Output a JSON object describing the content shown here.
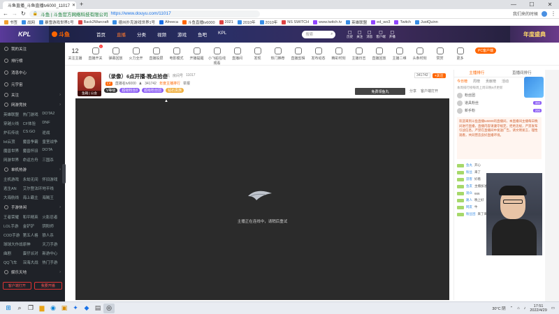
{
  "browser": {
    "tabs": [
      {
        "label": "斗鱼直播_斗鱼直播tv6000_11017"
      },
      {
        "label": "+"
      }
    ],
    "window_controls": [
      "—",
      "☐",
      "✕"
    ],
    "url_prefix": "斗鱼 | 斗鱼官方网络科技有限公司",
    "url": "https://www.douyu.com/11017",
    "address_right": "我们来的时候",
    "bookmarks": [
      {
        "label": "书签",
        "color": "#f0a030"
      },
      {
        "label": "战网",
        "color": "#3a8ee6"
      },
      {
        "label": "暴雪游戏世界1号",
        "color": "#3a8ee6"
      },
      {
        "label": "Back2Warcraft",
        "color": "#d44"
      },
      {
        "label": "德州扑克游戏世界1号",
        "color": "#3a8ee6"
      },
      {
        "label": "Afreeca",
        "color": "#1a6ee6"
      },
      {
        "label": "斗鱼直播tv6000",
        "color": "#f60"
      },
      {
        "label": "2021",
        "color": "#d44"
      },
      {
        "label": "2010年",
        "color": "#3a8ee6"
      },
      {
        "label": "2010年",
        "color": "#3a8ee6"
      },
      {
        "label": "NS SWITCH",
        "color": "#d44"
      },
      {
        "label": "www.twitch.tv",
        "color": "#9146ff"
      },
      {
        "label": "英雄联盟",
        "color": "#3a8ee6"
      },
      {
        "label": "ed_wo3",
        "color": "#9146ff"
      },
      {
        "label": "Twitch",
        "color": "#9146ff"
      },
      {
        "label": "JustQuinn",
        "color": "#3a8ee6"
      }
    ]
  },
  "site": {
    "logo_text": "斗鱼",
    "kpl_text": "KPL",
    "nav": [
      "首页",
      "直播",
      "分类",
      "视频",
      "游戏",
      "鱼吧",
      "KPL"
    ],
    "search_placeholder": "搜索",
    "header_icons": [
      "历史",
      "关注",
      "消息",
      "客户端",
      "开播"
    ],
    "banner_text": "年度盛典"
  },
  "sidebar": {
    "main_items": [
      "我的关注",
      "排行榜",
      "消息中心",
      "元宇宙"
    ],
    "follow_label": "关注",
    "sections": [
      {
        "title": "网游竞技",
        "items": [
          "英雄联盟",
          "热门游戏",
          "DOTA2",
          "穿越火线",
          "CF体验",
          "DNF",
          "炉石传说",
          "CS:GO",
          "逆战",
          "lol云顶",
          "魔兽争霸",
          "皇室战争",
          "魔兽世界",
          "魔兽怀旧",
          "DOTA",
          "网游世界",
          "命运方舟",
          "三国杀"
        ]
      },
      {
        "title": "单机热游",
        "items": [
          "主机游戏",
          "永劫无间",
          "怀旧游戏",
          "逃生AN",
          "艾尔登法环",
          "地平线",
          "大海航线",
          "海上霸主",
          "海贼王"
        ]
      },
      {
        "title": "手游休闲",
        "items": [
          "王者荣耀",
          "和平精英",
          "火影忍者",
          "LOL手游",
          "金铲铲",
          "阴阳师",
          "COD手游",
          "第五人格",
          "狼人杀",
          "球球大作战",
          "原神",
          "天刀手游",
          "曲剧",
          "蛋仔派对",
          "新游中心",
          "QQ飞车",
          "深海大战",
          "热门手游"
        ]
      },
      {
        "title": "娱乐天地",
        "items": []
      }
    ],
    "bottom_buttons": [
      "客户端打开",
      "我要开播"
    ]
  },
  "categories": [
    {
      "label": "12",
      "sub": "关注主播"
    },
    {
      "label": "直播开关",
      "badge": "1"
    },
    {
      "label": "弹幕回放"
    },
    {
      "label": "火力全开"
    },
    {
      "label": "直播投屏"
    },
    {
      "label": "电影模式"
    },
    {
      "label": "开播提醒"
    },
    {
      "label": "小飞船在线观看"
    },
    {
      "label": "直播间"
    },
    {
      "label": "发现"
    },
    {
      "label": "热门推荐"
    },
    {
      "label": "直播剪辑"
    },
    {
      "label": "发布动态"
    },
    {
      "label": "精彩时刻"
    },
    {
      "label": "主播日志"
    },
    {
      "label": "直播回放"
    },
    {
      "label": "主播二维"
    },
    {
      "label": "头条时刻"
    },
    {
      "label": "赞赏"
    },
    {
      "label": "更多"
    },
    {
      "label": "PC客户端",
      "highlight": true
    }
  ],
  "room": {
    "title": "（录像）6点开播-晚点拾叁",
    "category": "单机",
    "room_label": "房间号",
    "room_number": "11017",
    "streamer": "直播名tv6000",
    "followers": "341742",
    "rank_text": "年度主播排行",
    "report_label": "举报",
    "tags": [
      {
        "label": "V等级",
        "color": "#333"
      },
      {
        "label": "超级粉丝8",
        "color": "#8a5cf5"
      },
      {
        "label": "超级粉丝团",
        "color": "#8a5cf5"
      },
      {
        "label": "钻石贵族",
        "color": "#f0b040"
      }
    ],
    "follow_count": "341742",
    "follow_button": "+关注",
    "gift_text": "免费领鱼丸",
    "share_label": "分享",
    "client_label": "客户端打开",
    "avatar_caption": "鱼箱 | 公会"
  },
  "player": {
    "loading_text": "主播正在连线中，请稍后重试"
  },
  "right": {
    "tabs": [
      "主播排行",
      "直播间排行"
    ],
    "subtabs": [
      "今日榜",
      "周榜",
      "贡献榜",
      "活动"
    ],
    "notice": "本周排行榜每周上周日晚8点更新",
    "fans": [
      {
        "name": "粉丝团",
        "score": "300"
      },
      {
        "name": "道具粉丝",
        "score": "300"
      },
      {
        "name": "新手粉",
        "score": "200"
      }
    ],
    "announcement": "欢迎来到斗鱼直播tv6000的直播间，本直播间主播每日晚间进行直播，直播内容请遵守规定，拒绝违规，严禁发布引战信息。严禁在直播间中发送广告。请文明发言，理性观看，共同营造良好直播环境。",
    "chat": [
      {
        "user": "鱼丸",
        "msg": "开心"
      },
      {
        "user": "粉丝",
        "msg": "来了"
      },
      {
        "user": "游客",
        "msg": "好看"
      },
      {
        "user": "鱼友",
        "msg": "主播加油"
      },
      {
        "user": "观众",
        "msg": "666"
      },
      {
        "user": "路人",
        "msg": "晚上好"
      },
      {
        "user": "网友",
        "msg": "牛"
      },
      {
        "user": "粉丝团",
        "msg": "来了来了"
      }
    ]
  },
  "taskbar": {
    "weather": "30°C 阴",
    "time": "17:51",
    "date": "2022/4/29"
  }
}
